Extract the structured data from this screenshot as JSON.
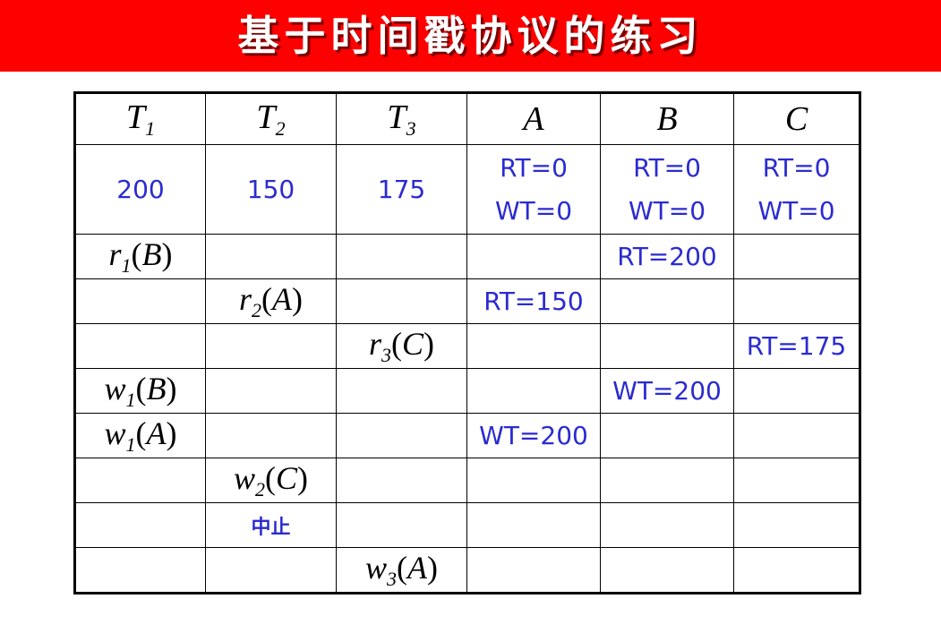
{
  "title": "基于时间戳协议的练习",
  "header": {
    "t1": "T",
    "t1_sub": "1",
    "t2": "T",
    "t2_sub": "2",
    "t3": "T",
    "t3_sub": "3",
    "a": "A",
    "b": "B",
    "c": "C"
  },
  "timestamps": {
    "t1": "200",
    "t2": "150",
    "t3": "175"
  },
  "initial": {
    "a_rt": "RT=0",
    "a_wt": "WT=0",
    "b_rt": "RT=0",
    "b_wt": "WT=0",
    "c_rt": "RT=0",
    "c_wt": "WT=0"
  },
  "ops": {
    "r1b": {
      "op": "r",
      "sub": "1",
      "open": "(",
      "item": "B",
      "close": ")",
      "result": "RT=200"
    },
    "r2a": {
      "op": "r",
      "sub": "2",
      "open": "(",
      "item": "A",
      "close": ")",
      "result": "RT=150"
    },
    "r3c": {
      "op": "r",
      "sub": "3",
      "open": "(",
      "item": "C",
      "close": ")",
      "result": "RT=175"
    },
    "w1b": {
      "op": "w",
      "sub": "1",
      "open": "(",
      "item": "B",
      "close": ")",
      "result": "WT=200"
    },
    "w1a": {
      "op": "w",
      "sub": "1",
      "open": "(",
      "item": "A",
      "close": ")",
      "result": "WT=200"
    },
    "w2c": {
      "op": "w",
      "sub": "2",
      "open": "(",
      "item": "C",
      "close": ")"
    },
    "abort": "中止",
    "w3a": {
      "op": "w",
      "sub": "3",
      "open": "(",
      "item": "A",
      "close": ")"
    }
  },
  "colors": {
    "title_bg": "#ff0000",
    "title_text": "#ffffff",
    "value_text": "#2b2bd1"
  }
}
